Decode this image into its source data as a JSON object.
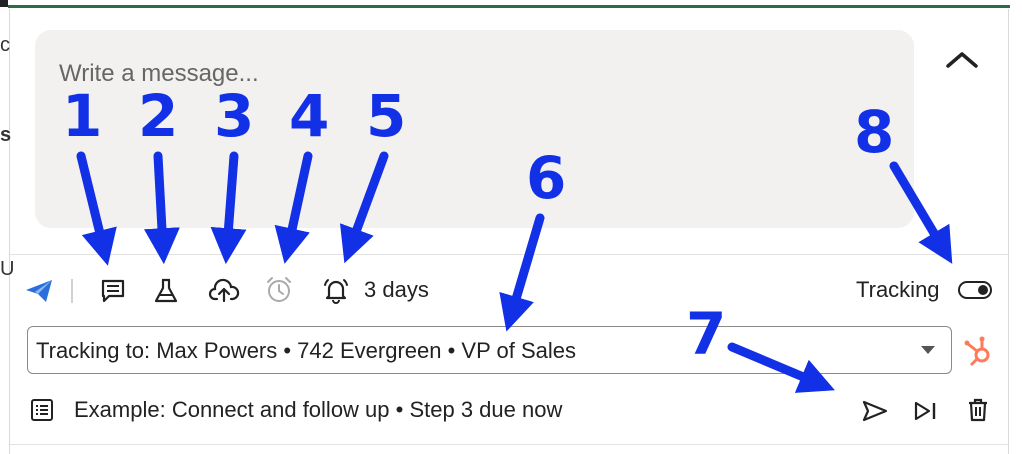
{
  "composer": {
    "placeholder": "Write a message...",
    "reminder_days": "3 days",
    "tracking_label": "Tracking",
    "tracking_on": true,
    "tracking_to": "Tracking to: Max Powers • 742 Evergreen • VP of Sales",
    "sequence_step": "Example: Connect and follow up • Step 3 due now"
  },
  "left_fragments": [
    "c",
    "s",
    "U"
  ],
  "annotations": [
    "1",
    "2",
    "3",
    "4",
    "5",
    "6",
    "7",
    "8"
  ],
  "colors": {
    "annotation": "#1230e6",
    "accent_green": "#2e6b46",
    "hubspot": "#ff7a59",
    "send_icon_blue": "#2a6fdb"
  }
}
